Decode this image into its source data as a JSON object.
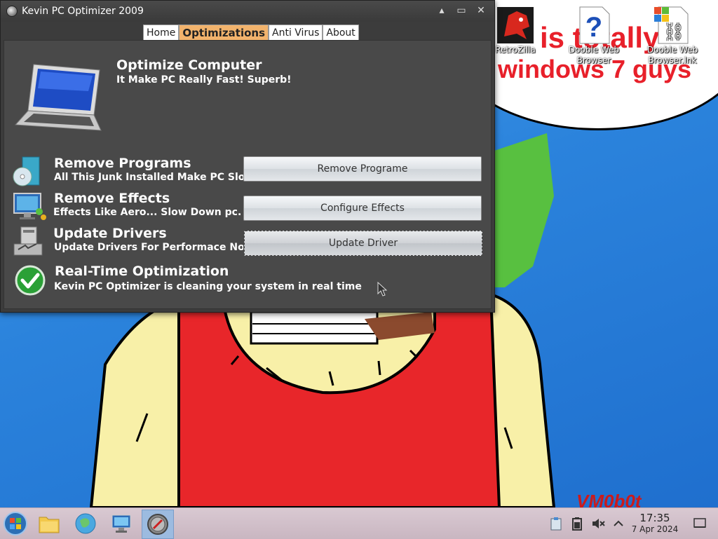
{
  "window": {
    "title": "Kevin PC Optimizer 2009",
    "controls": {
      "minimize": "▴",
      "maximize": "▭",
      "close": "✕"
    }
  },
  "tabs": [
    {
      "label": "Home",
      "active": false
    },
    {
      "label": "Optimizations",
      "active": true
    },
    {
      "label": "Anti Virus",
      "active": false
    },
    {
      "label": "About",
      "active": false
    }
  ],
  "optimize": {
    "title": "Optimize Computer",
    "subtitle": "It Make PC Really Fast! Superb!"
  },
  "sections": {
    "remove_programs": {
      "title": "Remove Programs",
      "desc": "All This Junk Installed Make PC Slow",
      "button": "Remove Programe"
    },
    "remove_effects": {
      "title": "Remove Effects",
      "desc": "Effects Like Aero... Slow Down pc.",
      "button": "Configure Effects"
    },
    "update_drivers": {
      "title": "Update Drivers",
      "desc": "Update Drivers For Performace Now",
      "button": "Update Driver"
    },
    "realtime": {
      "title": "Real-Time Optimization",
      "desc": "Kevin PC Optimizer is cleaning your system in real time"
    }
  },
  "desktop": {
    "bubble_line1": "is totally",
    "bubble_line2": "windows 7 guys",
    "watermark": "VM0b0t",
    "icons": [
      {
        "label": "RetroZilla",
        "icon": "dinosaur-icon"
      },
      {
        "label": "Dooble Web Browser",
        "icon": "question-icon"
      },
      {
        "label": "Dooble Web Browser.lnk",
        "icon": "link-icon"
      }
    ]
  },
  "taskbar": {
    "clock_time": "17:35",
    "clock_date": "7 Apr 2024"
  },
  "colors": {
    "tab_active": "#f2b36c",
    "window_bg": "#3c3c3c",
    "panel_bg": "#494949",
    "desktop_blue": "#2b83dc",
    "bubble_text": "#e8202a"
  }
}
